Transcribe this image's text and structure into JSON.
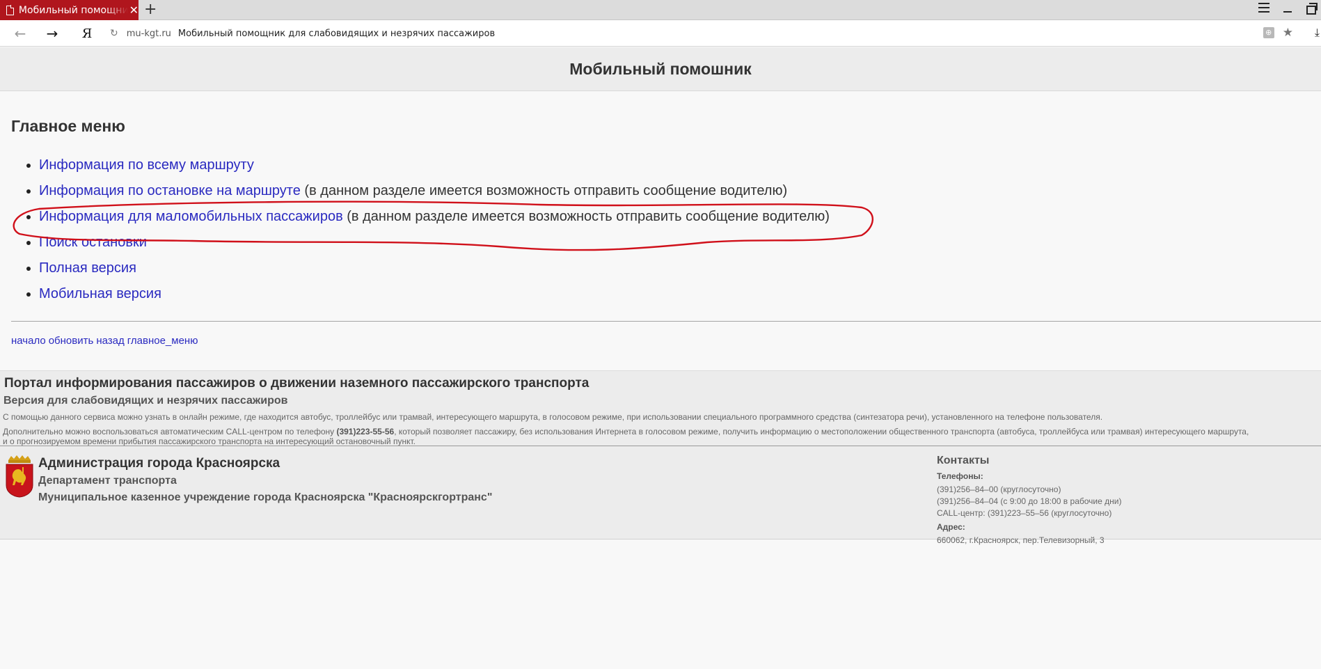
{
  "browser": {
    "tab_title": "Мобильный помощник для слабовидящих и незрячих пассажиров",
    "tab_close": "✕",
    "new_tab": "+",
    "yandex_button": "Я",
    "domain": "mu-kgt.ru",
    "page_title": "Мобильный помощник для слабовидящих и незрячих пассажиров"
  },
  "header": {
    "title": "Мобильный помошник"
  },
  "menu": {
    "title": "Главное меню",
    "items": [
      {
        "label": "Информация по всему маршруту",
        "note": ""
      },
      {
        "label": "Информация по остановке на маршруте",
        "note": " (в данном разделе имеется возможность отправить сообщение водителю)"
      },
      {
        "label": "Информация для маломобильных пассажиров",
        "note": " (в данном разделе имеется возможность отправить сообщение водителю)"
      },
      {
        "label": "Поиск остановки",
        "note": ""
      },
      {
        "label": "Полная версия",
        "note": ""
      },
      {
        "label": "Мобильная версия",
        "note": ""
      }
    ]
  },
  "bottom_links": [
    "начало",
    "обновить",
    "назад",
    "главное_меню"
  ],
  "portal": {
    "title": "Портал информирования пассажиров о движении наземного пассажирского транспорта",
    "subtitle": "Версия для слабовидящих и незрячих пассажиров",
    "text1": "С помощью данного сервиса можно узнать в онлайн режиме, где находится автобус, троллейбус или трамвай, интересующего маршрута, в голосовом режиме, при использовании специального программного средства (синтезатора речи), установленного на телефоне пользователя.",
    "text2_before": "Дополнительно можно воспользоваться автоматическим CALL-центром по телефону ",
    "text2_phone": "(391)223-55-56",
    "text2_after": ", который позволяет пассажиру, без использования Интернета в голосовом режиме, получить информацию о местоположении общественного транспорта (автобуса, троллейбуса или трамвая) интересующего маршрута,",
    "text3": "и о прогнозируемом времени прибытия пассажирского транспорта на интересующий остановочный пункт."
  },
  "footer": {
    "admin_title": "Администрация города Красноярска",
    "department": "Департамент транспорта",
    "organization": "Муниципальное казенное учреждение города Красноярска \"Красноярскгортранс\"",
    "contacts": {
      "title": "Контакты",
      "phones_label": "Телефоны:",
      "phones": [
        "(391)256–84–00 (круглосуточно)",
        "(391)256–84–04 (с 9:00 до 18:00 в рабочие дни)",
        "CALL-центр: (391)223–55–56 (круглосуточно)"
      ],
      "address_label": "Адрес:",
      "address": "660062, г.Красноярск, пер.Телевизорный, 3"
    }
  },
  "colors": {
    "tab_active": "#b0161d",
    "link": "#2a2ac0",
    "annotation": "#d0101a"
  }
}
